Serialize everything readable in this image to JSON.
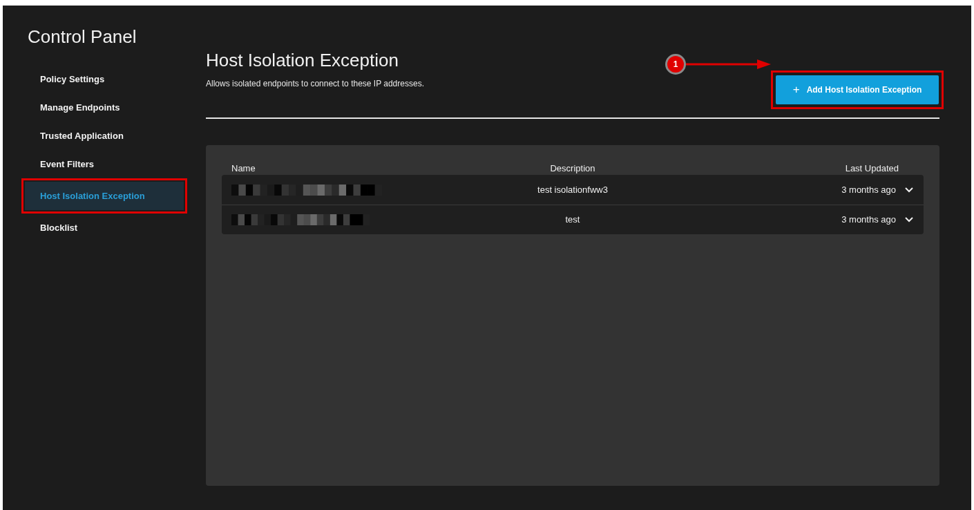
{
  "sidebar": {
    "title": "Control Panel",
    "items": [
      {
        "label": "Policy Settings",
        "selected": false,
        "highlighted": false
      },
      {
        "label": "Manage Endpoints",
        "selected": false,
        "highlighted": false
      },
      {
        "label": "Trusted Application",
        "selected": false,
        "highlighted": false
      },
      {
        "label": "Event Filters",
        "selected": false,
        "highlighted": false
      },
      {
        "label": "Host Isolation Exception",
        "selected": true,
        "highlighted": true
      },
      {
        "label": "Blocklist",
        "selected": false,
        "highlighted": false
      }
    ]
  },
  "page": {
    "title": "Host Isolation Exception",
    "subtitle": "Allows isolated endpoints to connect to these IP addresses.",
    "add_button": {
      "icon": "+",
      "label": "Add Host Isolation Exception",
      "highlighted": true
    },
    "callout": {
      "label": "1"
    }
  },
  "table": {
    "columns": [
      "Name",
      "Description",
      "Last Updated"
    ],
    "rows": [
      {
        "description": "test isolationfww3",
        "last_updated": "3 months ago",
        "expanded": false
      },
      {
        "description": "test",
        "last_updated": "3 months ago",
        "expanded": false
      }
    ]
  }
}
